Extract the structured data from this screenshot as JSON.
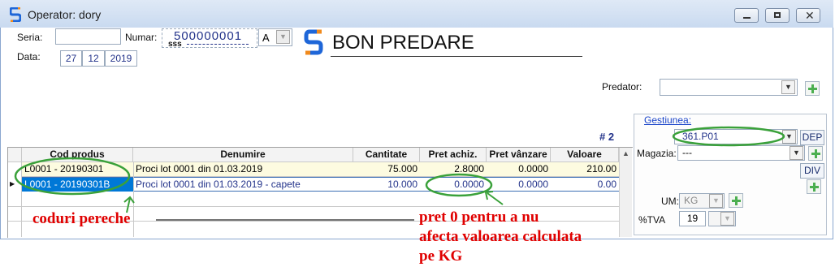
{
  "window": {
    "title": "Operator: dory"
  },
  "header": {
    "seria_label": "Seria:",
    "seria_value": "",
    "numar_label": "Numar:",
    "numar_value": "500000001",
    "numar_sub": "sss",
    "numar_letter": "A",
    "data_label": "Data:",
    "date_day": "27",
    "date_month": "12",
    "date_year": "2019",
    "doc_title": "BON PREDARE"
  },
  "predator": {
    "label": "Predator:",
    "value": ""
  },
  "count_label": "# 2",
  "table": {
    "columns": [
      "Cod produs",
      "Denumire",
      "Cantitate",
      "Pret achiz.",
      "Pret vânzare",
      "Valoare"
    ],
    "rows": [
      {
        "cod": "L0001 - 20190301",
        "denumire": "Proci lot 0001 din 01.03.2019",
        "cantitate": "75.000",
        "pret_achiz": "2.8000",
        "pret_vanzare": "0.0000",
        "valoare": "210.00"
      },
      {
        "cod": "L0001 - 20190301B",
        "denumire": "Proci lot 0001 din 01.03.2019 - capete",
        "cantitate": "10.000",
        "pret_achiz": "0.0000",
        "pret_vanzare": "0.0000",
        "valoare": "0.00"
      }
    ]
  },
  "side": {
    "gestiunea_label": "Gestiunea:",
    "gestiunea_value": "361.P01",
    "dep_label": "DEP",
    "magazia_label": "Magazia:",
    "magazia_value": "---",
    "div_label": "DIV",
    "um_label": "UM:",
    "um_value": "KG",
    "tva_label": "%TVA",
    "tva_value": "19"
  },
  "annotations": {
    "left": "coduri pereche",
    "right_line1": "pret 0 pentru a nu",
    "right_line2": "afecta valoarea calculata",
    "right_line3": "pe KG"
  },
  "colors": {
    "accent": "#0078d7",
    "highlight_row": "#fdfbe0",
    "annotation": "#e00000",
    "ellipse": "#3aa13a"
  }
}
